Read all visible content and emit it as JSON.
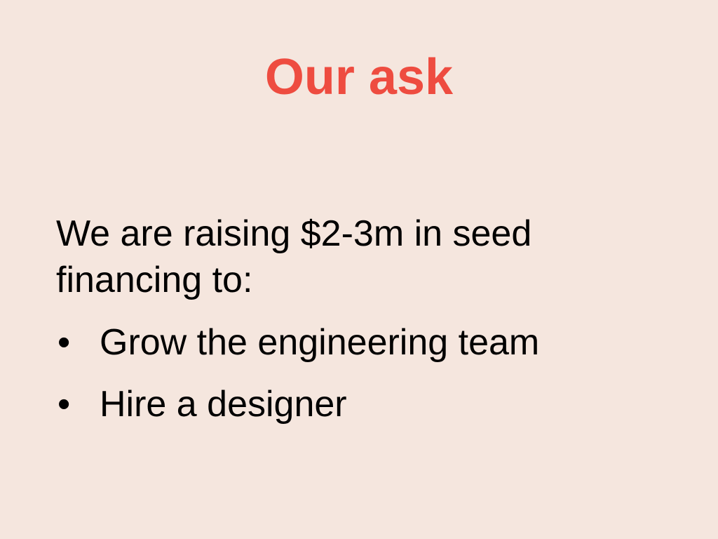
{
  "slide": {
    "title": "Our ask",
    "intro": "We are raising $2-3m in seed financing to:",
    "bullets": [
      {
        "marker": "•",
        "text": "Grow the engineering team"
      },
      {
        "marker": "•",
        "text": "Hire a designer"
      }
    ]
  },
  "colors": {
    "background": "#f5e6de",
    "title": "#ee4c40",
    "text": "#000000"
  }
}
